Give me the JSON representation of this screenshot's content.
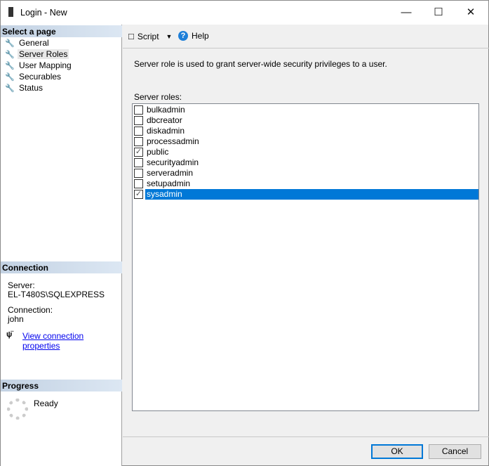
{
  "window": {
    "title": "Login - New",
    "controls": [
      "minimize",
      "maximize",
      "close"
    ]
  },
  "left": {
    "select_header": "Select a page",
    "pages": [
      {
        "label": "General"
      },
      {
        "label": "Server Roles",
        "selected": true
      },
      {
        "label": "User Mapping"
      },
      {
        "label": "Securables"
      },
      {
        "label": "Status"
      }
    ],
    "connection_header": "Connection",
    "server_label": "Server:",
    "server_value": "EL-T480S\\SQLEXPRESS",
    "connection_label": "Connection:",
    "connection_value": "john",
    "view_props": "View connection properties",
    "progress_header": "Progress",
    "progress_status": "Ready"
  },
  "toolbar": {
    "script": "Script",
    "help": "Help"
  },
  "main": {
    "description": "Server role is used to grant server-wide security privileges to a user.",
    "roles_label": "Server roles:",
    "roles": [
      {
        "name": "bulkadmin",
        "checked": false
      },
      {
        "name": "dbcreator",
        "checked": false
      },
      {
        "name": "diskadmin",
        "checked": false
      },
      {
        "name": "processadmin",
        "checked": false
      },
      {
        "name": "public",
        "checked": true
      },
      {
        "name": "securityadmin",
        "checked": false
      },
      {
        "name": "serveradmin",
        "checked": false
      },
      {
        "name": "setupadmin",
        "checked": false
      },
      {
        "name": "sysadmin",
        "checked": true,
        "selected": true
      }
    ]
  },
  "buttons": {
    "ok": "OK",
    "cancel": "Cancel"
  },
  "colors": {
    "selection": "#0078d7",
    "section_header": "#c3d2e3",
    "link": "#0000ee"
  }
}
